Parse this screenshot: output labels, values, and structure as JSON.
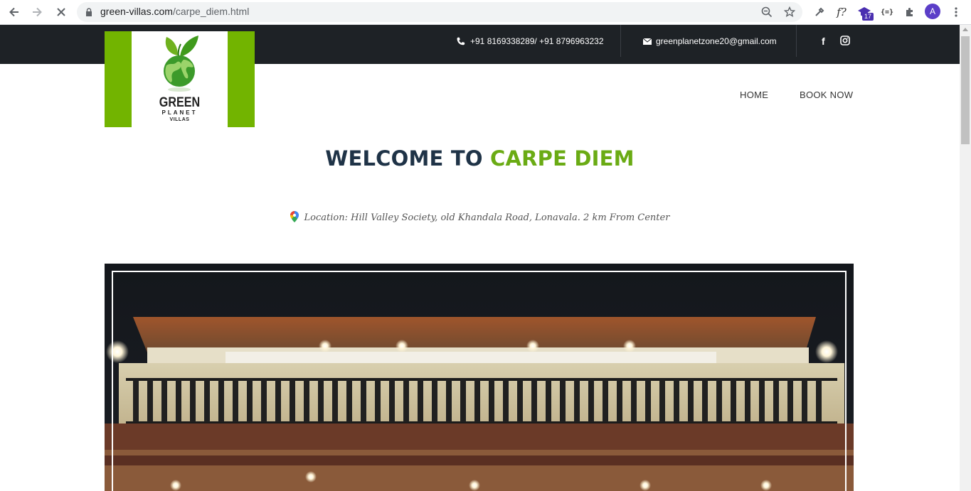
{
  "browser": {
    "url_domain": "green-villas.com",
    "url_path": "/carpe_diem.html",
    "avatar_letter": "A",
    "extension_badge": "17",
    "ext_f_label": "f?",
    "ext_braces_label": "{=}"
  },
  "topbar": {
    "phone": "+91 8169338289/ +91 8796963232",
    "email": "greenplanetzone20@gmail.com",
    "social": [
      "f",
      "◙"
    ]
  },
  "logo": {
    "line1": "GREEN",
    "line2": "PLANET",
    "line3": "VILLAS"
  },
  "nav": {
    "home": "HOME",
    "book": "BOOK NOW"
  },
  "heading": {
    "part1": "WELCOME TO",
    "part2": "CARPE DIEM"
  },
  "location": "Location: Hill Valley Society, old Khandala Road, Lonavala. 2 km From Center",
  "colors": {
    "brand_green": "#72b400",
    "heading_dark": "#1f3347",
    "topbar_bg": "#1e2226"
  }
}
